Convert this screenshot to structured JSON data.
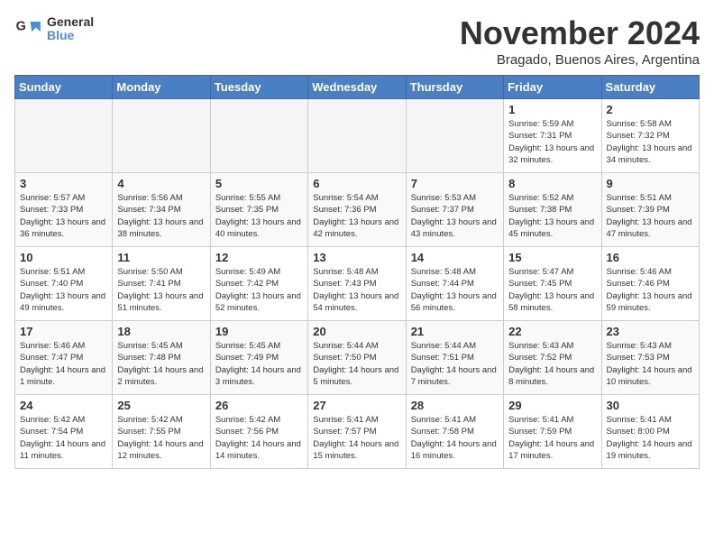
{
  "header": {
    "logo_line1": "General",
    "logo_line2": "Blue",
    "month_title": "November 2024",
    "subtitle": "Bragado, Buenos Aires, Argentina"
  },
  "weekdays": [
    "Sunday",
    "Monday",
    "Tuesday",
    "Wednesday",
    "Thursday",
    "Friday",
    "Saturday"
  ],
  "weeks": [
    [
      {
        "day": "",
        "info": ""
      },
      {
        "day": "",
        "info": ""
      },
      {
        "day": "",
        "info": ""
      },
      {
        "day": "",
        "info": ""
      },
      {
        "day": "",
        "info": ""
      },
      {
        "day": "1",
        "info": "Sunrise: 5:59 AM\nSunset: 7:31 PM\nDaylight: 13 hours and 32 minutes."
      },
      {
        "day": "2",
        "info": "Sunrise: 5:58 AM\nSunset: 7:32 PM\nDaylight: 13 hours and 34 minutes."
      }
    ],
    [
      {
        "day": "3",
        "info": "Sunrise: 5:57 AM\nSunset: 7:33 PM\nDaylight: 13 hours and 36 minutes."
      },
      {
        "day": "4",
        "info": "Sunrise: 5:56 AM\nSunset: 7:34 PM\nDaylight: 13 hours and 38 minutes."
      },
      {
        "day": "5",
        "info": "Sunrise: 5:55 AM\nSunset: 7:35 PM\nDaylight: 13 hours and 40 minutes."
      },
      {
        "day": "6",
        "info": "Sunrise: 5:54 AM\nSunset: 7:36 PM\nDaylight: 13 hours and 42 minutes."
      },
      {
        "day": "7",
        "info": "Sunrise: 5:53 AM\nSunset: 7:37 PM\nDaylight: 13 hours and 43 minutes."
      },
      {
        "day": "8",
        "info": "Sunrise: 5:52 AM\nSunset: 7:38 PM\nDaylight: 13 hours and 45 minutes."
      },
      {
        "day": "9",
        "info": "Sunrise: 5:51 AM\nSunset: 7:39 PM\nDaylight: 13 hours and 47 minutes."
      }
    ],
    [
      {
        "day": "10",
        "info": "Sunrise: 5:51 AM\nSunset: 7:40 PM\nDaylight: 13 hours and 49 minutes."
      },
      {
        "day": "11",
        "info": "Sunrise: 5:50 AM\nSunset: 7:41 PM\nDaylight: 13 hours and 51 minutes."
      },
      {
        "day": "12",
        "info": "Sunrise: 5:49 AM\nSunset: 7:42 PM\nDaylight: 13 hours and 52 minutes."
      },
      {
        "day": "13",
        "info": "Sunrise: 5:48 AM\nSunset: 7:43 PM\nDaylight: 13 hours and 54 minutes."
      },
      {
        "day": "14",
        "info": "Sunrise: 5:48 AM\nSunset: 7:44 PM\nDaylight: 13 hours and 56 minutes."
      },
      {
        "day": "15",
        "info": "Sunrise: 5:47 AM\nSunset: 7:45 PM\nDaylight: 13 hours and 58 minutes."
      },
      {
        "day": "16",
        "info": "Sunrise: 5:46 AM\nSunset: 7:46 PM\nDaylight: 13 hours and 59 minutes."
      }
    ],
    [
      {
        "day": "17",
        "info": "Sunrise: 5:46 AM\nSunset: 7:47 PM\nDaylight: 14 hours and 1 minute."
      },
      {
        "day": "18",
        "info": "Sunrise: 5:45 AM\nSunset: 7:48 PM\nDaylight: 14 hours and 2 minutes."
      },
      {
        "day": "19",
        "info": "Sunrise: 5:45 AM\nSunset: 7:49 PM\nDaylight: 14 hours and 3 minutes."
      },
      {
        "day": "20",
        "info": "Sunrise: 5:44 AM\nSunset: 7:50 PM\nDaylight: 14 hours and 5 minutes."
      },
      {
        "day": "21",
        "info": "Sunrise: 5:44 AM\nSunset: 7:51 PM\nDaylight: 14 hours and 7 minutes."
      },
      {
        "day": "22",
        "info": "Sunrise: 5:43 AM\nSunset: 7:52 PM\nDaylight: 14 hours and 8 minutes."
      },
      {
        "day": "23",
        "info": "Sunrise: 5:43 AM\nSunset: 7:53 PM\nDaylight: 14 hours and 10 minutes."
      }
    ],
    [
      {
        "day": "24",
        "info": "Sunrise: 5:42 AM\nSunset: 7:54 PM\nDaylight: 14 hours and 11 minutes."
      },
      {
        "day": "25",
        "info": "Sunrise: 5:42 AM\nSunset: 7:55 PM\nDaylight: 14 hours and 12 minutes."
      },
      {
        "day": "26",
        "info": "Sunrise: 5:42 AM\nSunset: 7:56 PM\nDaylight: 14 hours and 14 minutes."
      },
      {
        "day": "27",
        "info": "Sunrise: 5:41 AM\nSunset: 7:57 PM\nDaylight: 14 hours and 15 minutes."
      },
      {
        "day": "28",
        "info": "Sunrise: 5:41 AM\nSunset: 7:58 PM\nDaylight: 14 hours and 16 minutes."
      },
      {
        "day": "29",
        "info": "Sunrise: 5:41 AM\nSunset: 7:59 PM\nDaylight: 14 hours and 17 minutes."
      },
      {
        "day": "30",
        "info": "Sunrise: 5:41 AM\nSunset: 8:00 PM\nDaylight: 14 hours and 19 minutes."
      }
    ]
  ]
}
